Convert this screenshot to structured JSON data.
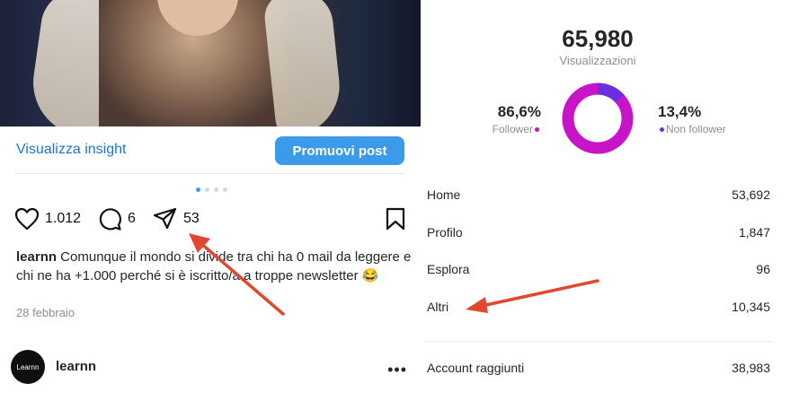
{
  "post": {
    "insight_link": "Visualizza insight",
    "promote_button": "Promuovi post",
    "carousel": {
      "count": 4,
      "active_index": 0
    },
    "likes": "1.012",
    "comments": "6",
    "shares": "53",
    "caption_user": "learnn",
    "caption_text": " Comunque il mondo si divide tra chi ha 0 mail da leggere e chi ne ha +1.000 perché si è iscritto/a a troppe newsletter 😂",
    "date": "28 febbraio",
    "author": {
      "avatar_text": "Learnn",
      "name": "learnn",
      "more_icon": "more-horizontal-icon"
    }
  },
  "insights": {
    "views_total": "65,980",
    "views_label": "Visualizzazioni",
    "follower_pct": "86,6%",
    "follower_label": "Follower",
    "nonfollower_pct": "13,4%",
    "nonfollower_label": "Non follower",
    "donut": {
      "follower_fraction": 0.866,
      "follower_color": "#c913c9",
      "nonfollower_color": "#6a2fe0"
    },
    "sources": [
      {
        "label": "Home",
        "value": "53,692"
      },
      {
        "label": "Profilo",
        "value": "1,847"
      },
      {
        "label": "Esplora",
        "value": "96"
      },
      {
        "label": "Altri",
        "value": "10,345"
      }
    ],
    "accounts_reached_label": "Account raggiunti",
    "accounts_reached_value": "38,983"
  },
  "colors": {
    "accent_blue": "#3b9aea",
    "link_blue": "#1877d4",
    "annotation_red": "#e2472f"
  }
}
